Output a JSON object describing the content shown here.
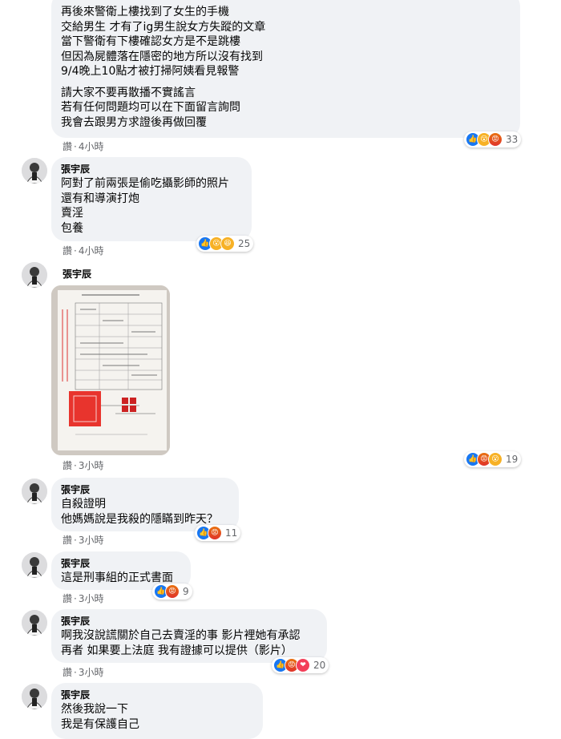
{
  "comment_top": {
    "lines_a": [
      "再後來警衛上樓找到了女生的手機",
      "交給男生 才有了ig男生說女方失蹤的文章",
      "當下警衛有下樓確認女方是不是跳樓",
      "但因為屍體落在隱密的地方所以沒有找到",
      "9/4晚上10點才被打掃阿姨看見報警"
    ],
    "lines_b": [
      "請大家不要再散播不實謠言",
      "若有任何問題均可以在下面留言詢問",
      "我會去跟男方求證後再做回覆"
    ],
    "reaction_count": "33",
    "time": "4小時"
  },
  "comments": [
    {
      "name": "張宇辰",
      "lines": [
        "阿對了前兩張是偷吃攝影師的照片",
        "還有和導演打炮",
        "賣淫",
        "包養"
      ],
      "reaction_count": "25",
      "time": "4小時"
    },
    {
      "name": "張宇辰",
      "reaction_count": "19",
      "time": "3小時"
    },
    {
      "name": "張宇辰",
      "lines": [
        "自殺證明",
        "他媽媽說是我殺的隱瞞到昨天？"
      ],
      "reaction_count": "11",
      "time": "3小時"
    },
    {
      "name": "張宇辰",
      "lines": [
        "這是刑事組的正式書面"
      ],
      "reaction_count": "9",
      "time": "3小時"
    },
    {
      "name": "張宇辰",
      "lines": [
        "啊我沒說謊關於自己去賣淫的事 影片裡她有承認",
        "再者 如果要上法庭 我有證據可以提供（影片）"
      ],
      "reaction_count": "20",
      "time": "3小時"
    },
    {
      "name": "張宇辰",
      "lines": [
        "然後我說一下",
        "我是有保護自己"
      ]
    }
  ],
  "ui": {
    "like_label": "讚",
    "dot": "·"
  },
  "icons": {
    "like": "thumbs-up-icon",
    "haha": "haha-icon",
    "wow": "wow-icon",
    "angry": "angry-icon",
    "love": "heart-icon"
  },
  "colors": {
    "like": "#1877f2",
    "angry": "#e9710f",
    "haha": "#f7b125",
    "love": "#f33e58",
    "bubble": "#f0f2f5",
    "meta": "#65676b"
  }
}
